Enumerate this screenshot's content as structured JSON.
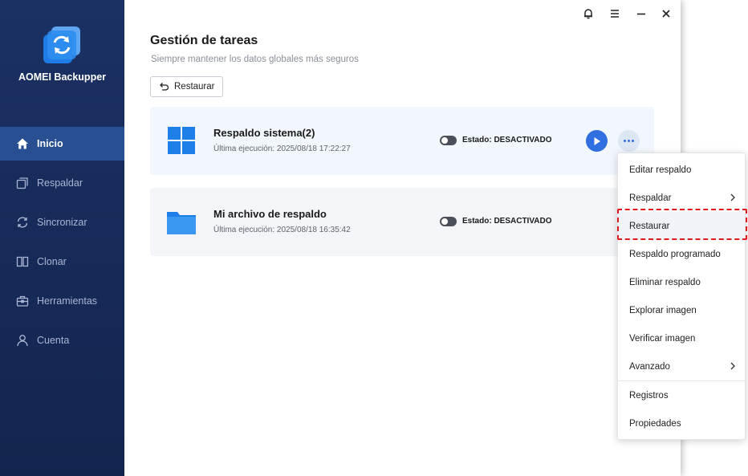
{
  "app": {
    "brand": "AOMEI Backupper",
    "accent": "#2f6fe0",
    "sidebar_bg": "#1b3164"
  },
  "sidebar": {
    "items": [
      {
        "label": "Inicio",
        "icon": "home-icon",
        "active": true
      },
      {
        "label": "Respaldar",
        "icon": "backup-icon"
      },
      {
        "label": "Sincronizar",
        "icon": "sync-icon"
      },
      {
        "label": "Clonar",
        "icon": "clone-icon"
      },
      {
        "label": "Herramientas",
        "icon": "toolbox-icon"
      },
      {
        "label": "Cuenta",
        "icon": "user-icon"
      }
    ]
  },
  "titlebar": {
    "buttons": [
      "bell-icon",
      "menu-icon",
      "minimize-icon",
      "close-icon"
    ]
  },
  "main": {
    "title": "Gestión de tareas",
    "subtitle": "Siempre mantener los datos globales más seguros",
    "restore_label": "Restaurar",
    "tasks": [
      {
        "name": "Respaldo sistema(2)",
        "last_run": "Última ejecución: 2025/08/18 17:22:27",
        "state": "Estado: DESACTIVADO",
        "icon": "windows-icon"
      },
      {
        "name": "Mi archivo de respaldo",
        "last_run": "Última ejecución: 2025/08/18 16:35:42",
        "state": "Estado: DESACTIVADO",
        "icon": "folder-icon"
      }
    ]
  },
  "context_menu": {
    "items": [
      {
        "label": "Editar respaldo"
      },
      {
        "label": "Respaldar",
        "submenu": true
      },
      {
        "label": "Restaurar",
        "highlighted": true
      },
      {
        "label": "Respaldo programado"
      },
      {
        "label": "Eliminar respaldo"
      },
      {
        "label": "Explorar imagen"
      },
      {
        "label": "Verificar imagen"
      },
      {
        "label": "Avanzado",
        "submenu": true
      },
      {
        "label": "Registros"
      },
      {
        "label": "Propiedades"
      }
    ]
  }
}
